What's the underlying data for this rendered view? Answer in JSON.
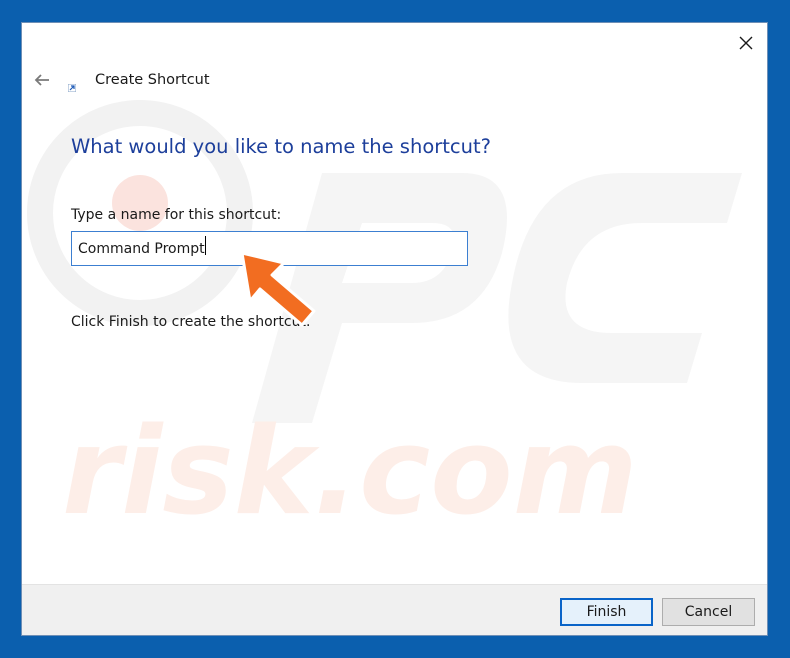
{
  "dialog": {
    "title": "Create Shortcut",
    "heading": "What would you like to name the shortcut?",
    "field_label": "Type a name for this shortcut:",
    "name_value": "Command Prompt",
    "hint": "Click Finish to create the shortcut."
  },
  "buttons": {
    "finish": "Finish",
    "cancel": "Cancel"
  },
  "icons": {
    "close": "close-icon",
    "back": "back-arrow-icon",
    "shortcut": "shortcut-icon",
    "annotation": "orange-pointer-arrow"
  },
  "colors": {
    "accent": "#1d3f9b",
    "focus_border": "#3c7fd1",
    "annotation": "#f26d21",
    "backdrop": "#0b5fae"
  },
  "watermark": "risk.com"
}
